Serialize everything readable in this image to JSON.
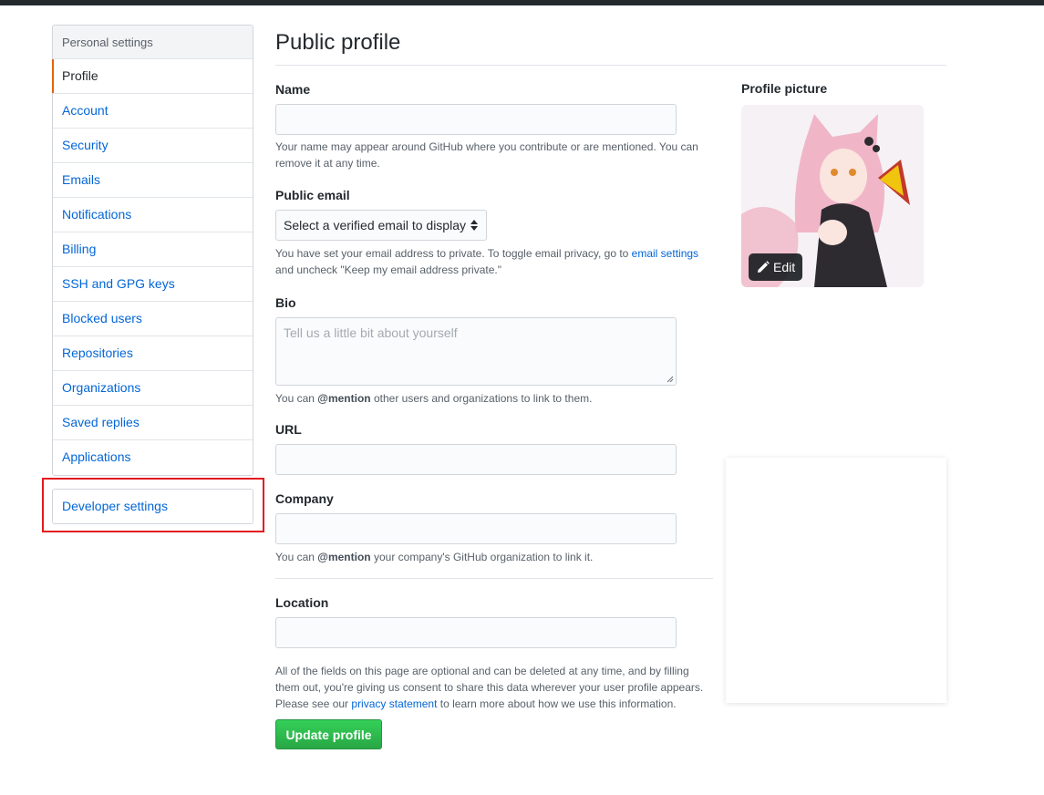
{
  "sidebar": {
    "heading": "Personal settings",
    "items": [
      {
        "label": "Profile"
      },
      {
        "label": "Account"
      },
      {
        "label": "Security"
      },
      {
        "label": "Emails"
      },
      {
        "label": "Notifications"
      },
      {
        "label": "Billing"
      },
      {
        "label": "SSH and GPG keys"
      },
      {
        "label": "Blocked users"
      },
      {
        "label": "Repositories"
      },
      {
        "label": "Organizations"
      },
      {
        "label": "Saved replies"
      },
      {
        "label": "Applications"
      }
    ],
    "developer_settings": "Developer settings"
  },
  "main": {
    "title": "Public profile",
    "name": {
      "label": "Name",
      "value": "",
      "note": "Your name may appear around GitHub where you contribute or are mentioned. You can remove it at any time."
    },
    "email": {
      "label": "Public email",
      "selected": "Select a verified email to display",
      "note_pre": "You have set your email address to private. To toggle email privacy, go to ",
      "note_link": "email settings",
      "note_post": " and uncheck \"Keep my email address private.\""
    },
    "bio": {
      "label": "Bio",
      "placeholder": "Tell us a little bit about yourself",
      "note_pre": "You can ",
      "note_bold": "@mention",
      "note_post": " other users and organizations to link to them."
    },
    "url": {
      "label": "URL",
      "value": ""
    },
    "company": {
      "label": "Company",
      "value": "",
      "note_pre": "You can ",
      "note_bold": "@mention",
      "note_post": " your company's GitHub organization to link it."
    },
    "location": {
      "label": "Location",
      "value": ""
    },
    "footer": {
      "pre": "All of the fields on this page are optional and can be deleted at any time, and by filling them out, you're giving us consent to share this data wherever your user profile appears. Please see our ",
      "link": "privacy statement",
      "post": " to learn more about how we use this information."
    },
    "submit_label": "Update profile"
  },
  "profile_picture": {
    "label": "Profile picture",
    "edit_label": "Edit"
  },
  "colors": {
    "link": "#0366d6",
    "selected_indicator": "#e36209",
    "primary_button": "#28a745",
    "highlight_box": "#e4191e"
  }
}
